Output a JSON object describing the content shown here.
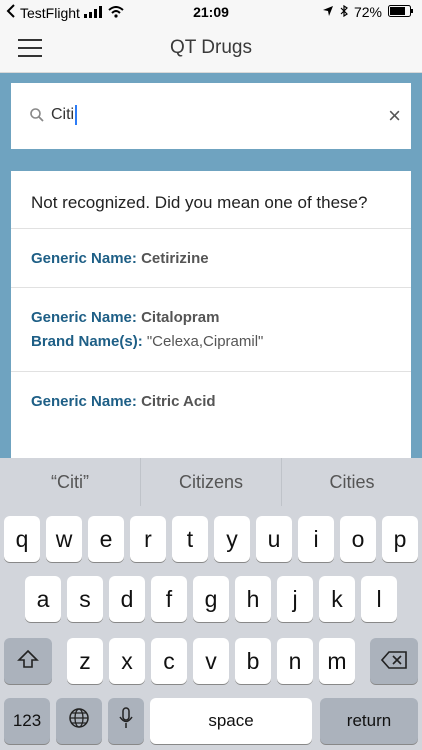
{
  "status_bar": {
    "app": "TestFlight",
    "time": "21:09",
    "battery": "72%"
  },
  "header": {
    "title": "QT Drugs"
  },
  "search": {
    "value": "Citi"
  },
  "results": {
    "message": "Not recognized. Did you mean one of these?",
    "generic_label": "Generic Name:",
    "brand_label": "Brand Name(s):",
    "items": [
      {
        "generic": "Cetirizine"
      },
      {
        "generic": "Citalopram",
        "brand": "\"Celexa,Cipramil\""
      },
      {
        "generic": "Citric Acid"
      }
    ]
  },
  "suggestions": [
    "“Citi”",
    "Citizens",
    "Cities"
  ],
  "keyboard": {
    "row1": [
      "q",
      "w",
      "e",
      "r",
      "t",
      "y",
      "u",
      "i",
      "o",
      "p"
    ],
    "row2": [
      "a",
      "s",
      "d",
      "f",
      "g",
      "h",
      "j",
      "k",
      "l"
    ],
    "row3": [
      "z",
      "x",
      "c",
      "v",
      "b",
      "n",
      "m"
    ],
    "numbers": "123",
    "space": "space",
    "return": "return"
  }
}
